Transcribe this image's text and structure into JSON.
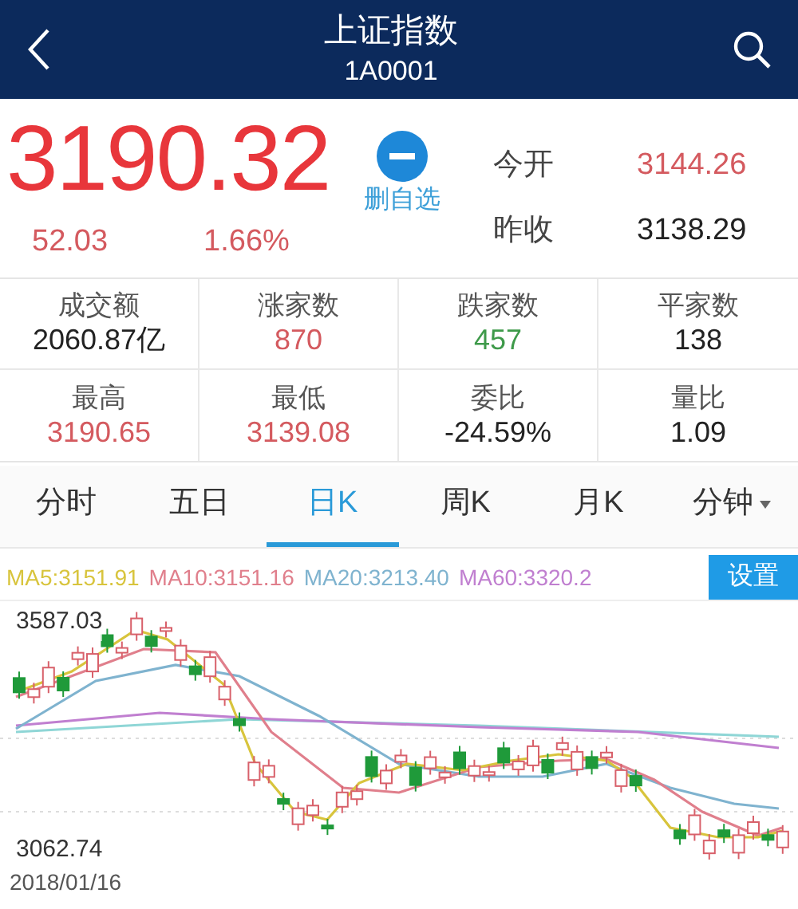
{
  "header": {
    "title": "上证指数",
    "code": "1A0001"
  },
  "quote": {
    "price": "3190.32",
    "change": "52.03",
    "change_percent": "1.66%",
    "watchlist_button": "删自选",
    "fields": [
      {
        "label": "今开",
        "value": "3144.26",
        "color": "#d45a5f"
      },
      {
        "label": "昨收",
        "value": "3138.29",
        "color": "#222222"
      }
    ]
  },
  "stats": [
    {
      "label": "成交额",
      "value": "2060.87亿",
      "color": "#222222"
    },
    {
      "label": "涨家数",
      "value": "870",
      "color": "#d45a5f"
    },
    {
      "label": "跌家数",
      "value": "457",
      "color": "#3e9a4a"
    },
    {
      "label": "平家数",
      "value": "138",
      "color": "#222222"
    },
    {
      "label": "最高",
      "value": "3190.65",
      "color": "#d45a5f"
    },
    {
      "label": "最低",
      "value": "3139.08",
      "color": "#d45a5f"
    },
    {
      "label": "委比",
      "value": "-24.59%",
      "color": "#222222"
    },
    {
      "label": "量比",
      "value": "1.09",
      "color": "#222222"
    }
  ],
  "tabs": [
    {
      "label": "分时",
      "selected": false,
      "dropdown": false
    },
    {
      "label": "五日",
      "selected": false,
      "dropdown": false
    },
    {
      "label": "日K",
      "selected": true,
      "dropdown": false
    },
    {
      "label": "周K",
      "selected": false,
      "dropdown": false
    },
    {
      "label": "月K",
      "selected": false,
      "dropdown": false
    },
    {
      "label": "分钟",
      "selected": false,
      "dropdown": true
    }
  ],
  "chart": {
    "indicators": [
      {
        "label": "MA5:3151.91",
        "color": "#d8c43c"
      },
      {
        "label": "MA10:3151.16",
        "color": "#e07f8c"
      },
      {
        "label": "MA20:3213.40",
        "color": "#7fb3cf"
      },
      {
        "label": "MA60:3320.2",
        "color": "#c07fd0"
      }
    ],
    "settings_button": "设置",
    "y_max_label": "3587.03",
    "y_min_label": "3062.74",
    "start_date": "2018/01/16"
  }
}
